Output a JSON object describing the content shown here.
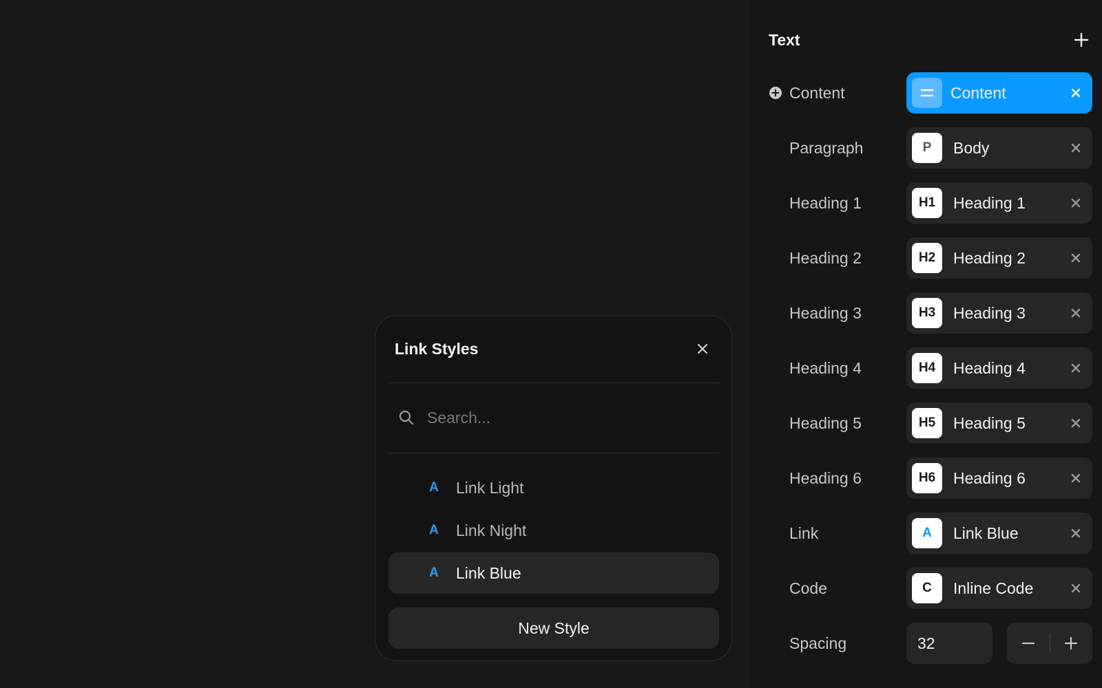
{
  "panel": {
    "title": "Text",
    "rows": [
      {
        "label": "Content",
        "badge": "=",
        "value": "Content",
        "active": true
      },
      {
        "label": "Paragraph",
        "badge": "P",
        "value": "Body"
      },
      {
        "label": "Heading 1",
        "badge": "H1",
        "value": "Heading 1"
      },
      {
        "label": "Heading 2",
        "badge": "H2",
        "value": "Heading 2"
      },
      {
        "label": "Heading 3",
        "badge": "H3",
        "value": "Heading 3"
      },
      {
        "label": "Heading 4",
        "badge": "H4",
        "value": "Heading 4"
      },
      {
        "label": "Heading 5",
        "badge": "H5",
        "value": "Heading 5"
      },
      {
        "label": "Heading 6",
        "badge": "H6",
        "value": "Heading 6"
      },
      {
        "label": "Link",
        "badge": "A",
        "value": "Link Blue"
      },
      {
        "label": "Code",
        "badge": "C",
        "value": "Inline Code"
      }
    ],
    "spacing": {
      "label": "Spacing",
      "value": "32"
    }
  },
  "popover": {
    "title": "Link Styles",
    "search_placeholder": "Search...",
    "items": [
      {
        "icon": "A",
        "label": "Link Light"
      },
      {
        "icon": "A",
        "label": "Link Night"
      },
      {
        "icon": "A",
        "label": "Link Blue",
        "selected": true
      }
    ],
    "new_style_label": "New Style"
  },
  "colors": {
    "background": "#171717",
    "chip": "#262626",
    "accent": "#0a99ff",
    "link_icon": "#2d9bf0"
  },
  "icons": {
    "add": "plus-icon",
    "content_add": "plus-circle-icon",
    "remove": "close-icon",
    "search": "search-icon",
    "decrement": "minus-icon",
    "increment": "plus-icon"
  }
}
